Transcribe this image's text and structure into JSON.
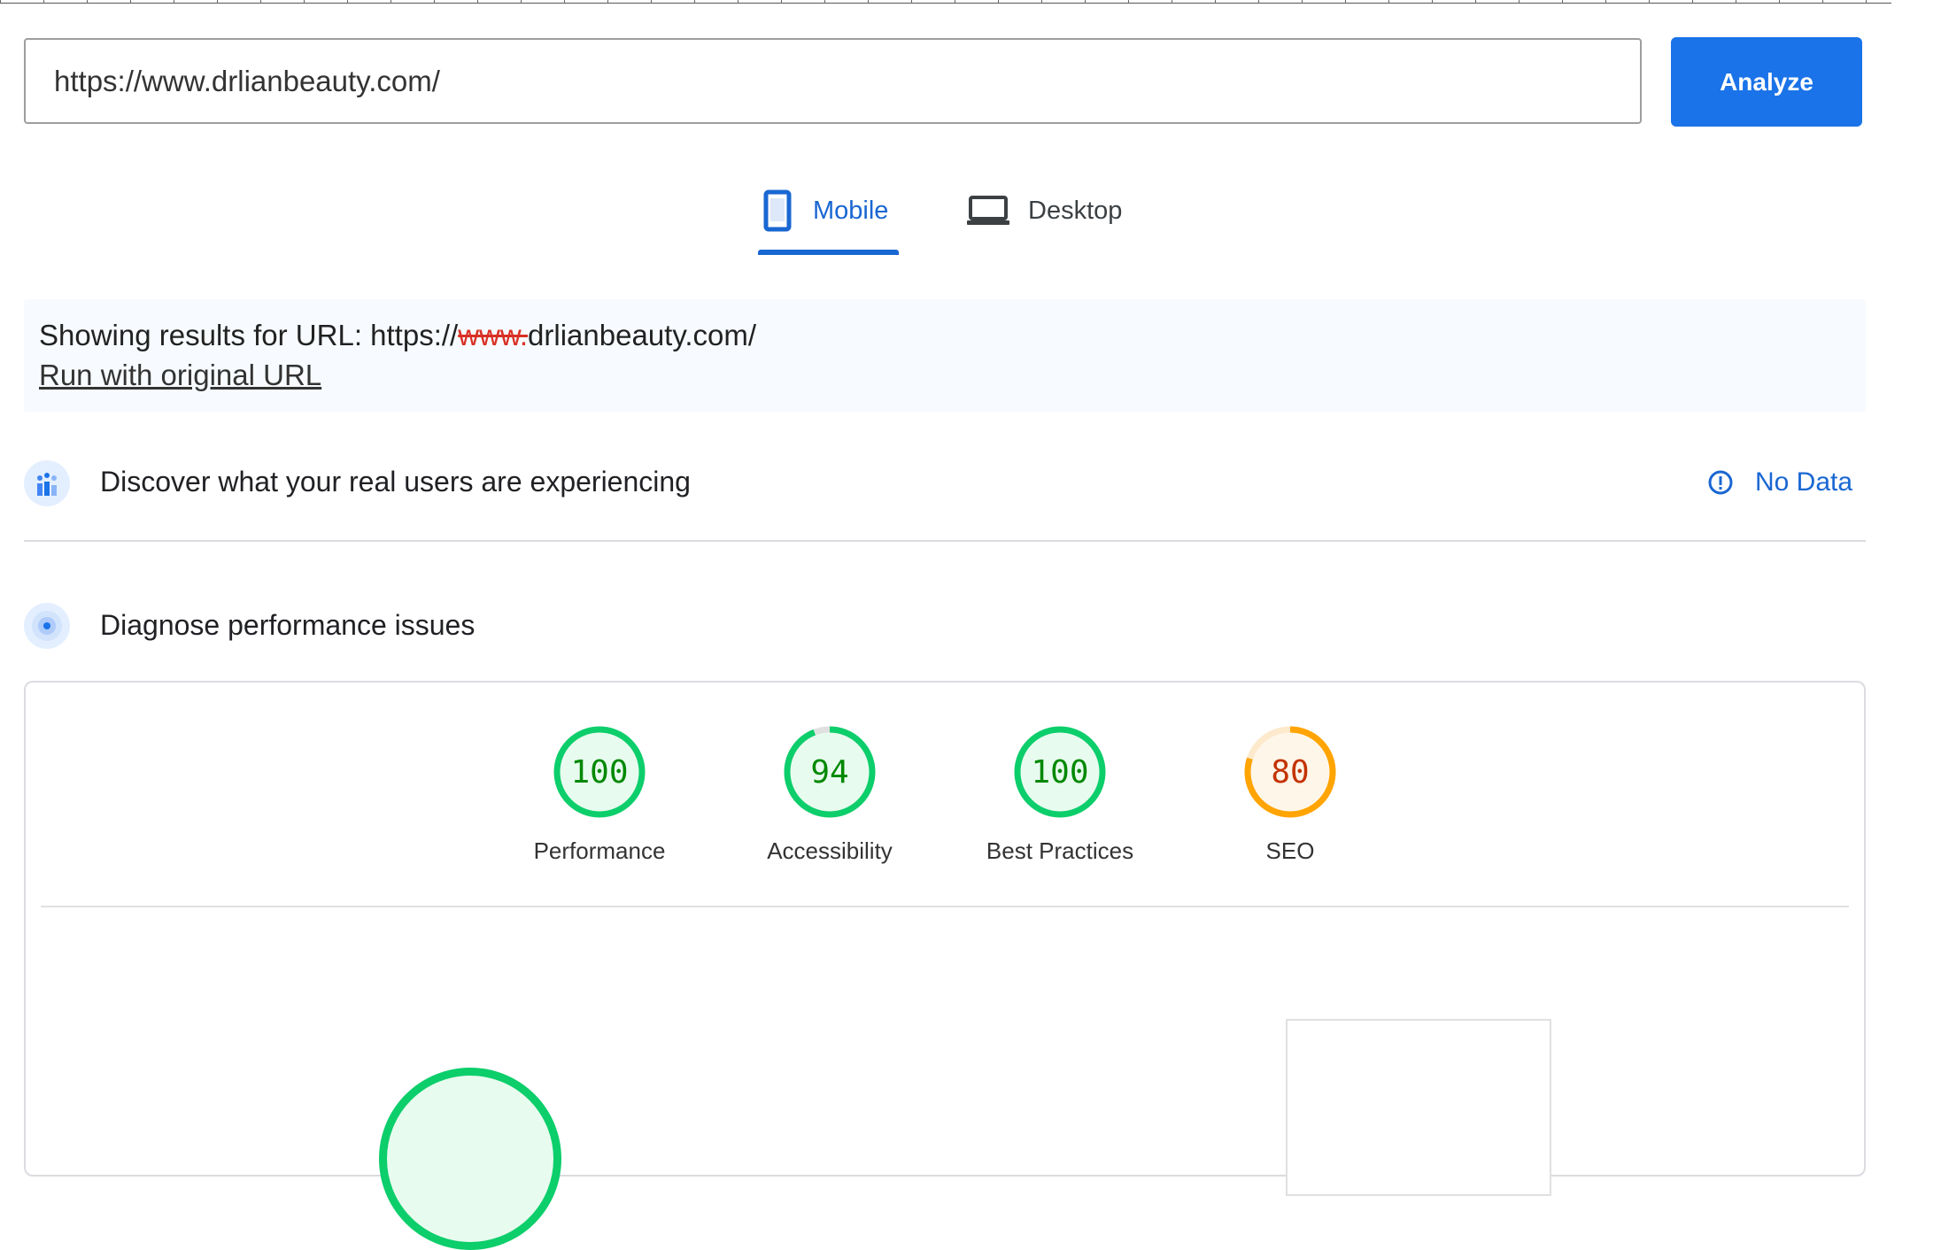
{
  "search": {
    "url_value": "https://www.drlianbeauty.com/",
    "analyze_label": "Analyze"
  },
  "tabs": [
    {
      "label": "Mobile",
      "active": true,
      "icon": "smartphone-icon"
    },
    {
      "label": "Desktop",
      "active": false,
      "icon": "laptop-icon"
    }
  ],
  "notice": {
    "prefix": "Showing results for URL: https://",
    "struck": "www.",
    "suffix": "drlianbeauty.com/",
    "link_label": "Run with original URL"
  },
  "field_data": {
    "title": "Discover what your real users are experiencing",
    "status": "No Data",
    "icon": "users-chart-icon",
    "status_icon": "info-icon"
  },
  "lab_data": {
    "title": "Diagnose performance issues",
    "icon": "diagnose-icon"
  },
  "scores": [
    {
      "label": "Performance",
      "value": "100",
      "color": "#0cce6b",
      "text_color": "#008800",
      "fill": "#e8fbef"
    },
    {
      "label": "Accessibility",
      "value": "94",
      "color": "#0cce6b",
      "text_color": "#008800",
      "fill": "#e8fbef"
    },
    {
      "label": "Best Practices",
      "value": "100",
      "color": "#0cce6b",
      "text_color": "#008800",
      "fill": "#e8fbef"
    },
    {
      "label": "SEO",
      "value": "80",
      "color": "#ffa400",
      "text_color": "#c33300",
      "fill": "#fff6ea"
    }
  ],
  "colors": {
    "accent": "#1a73e8",
    "pass": "#0cce6b",
    "average": "#ffa400"
  }
}
